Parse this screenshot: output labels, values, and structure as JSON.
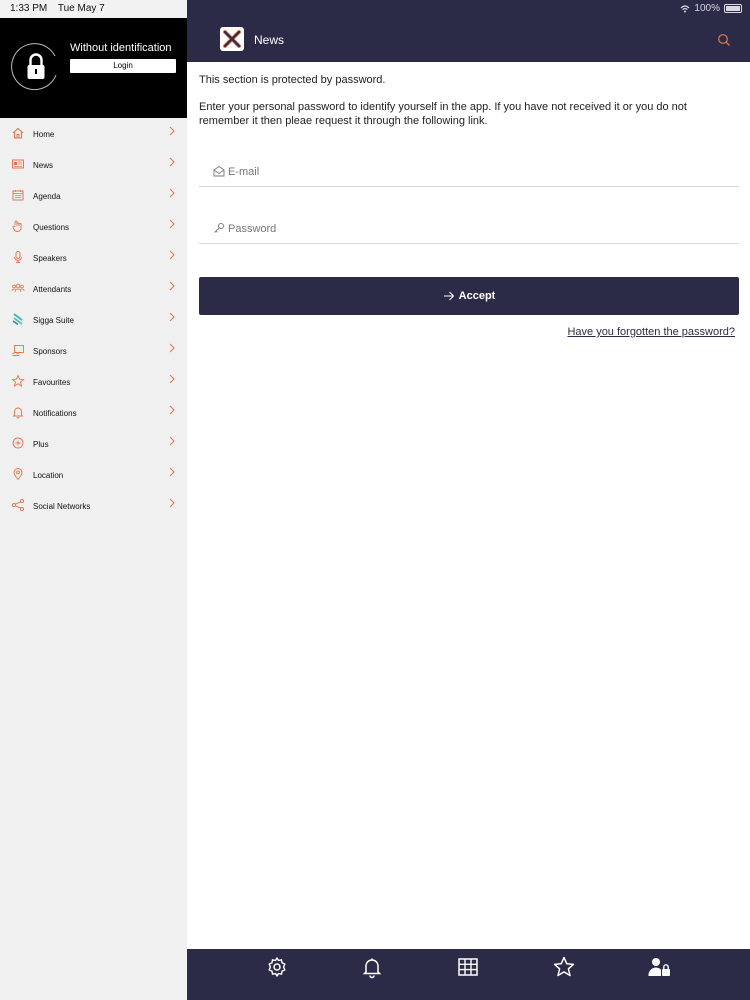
{
  "status_bar": {
    "time": "1:33 PM",
    "date": "Tue May 7",
    "battery": "100%"
  },
  "profile": {
    "name": "Without identification",
    "login_label": "Login"
  },
  "sidebar": {
    "items": [
      {
        "label": "Home",
        "icon": "home-icon"
      },
      {
        "label": "News",
        "icon": "newspaper-icon"
      },
      {
        "label": "Agenda",
        "icon": "calendar-icon"
      },
      {
        "label": "Questions",
        "icon": "hand-icon"
      },
      {
        "label": "Speakers",
        "icon": "microphone-icon"
      },
      {
        "label": "Attendants",
        "icon": "people-icon"
      },
      {
        "label": "Sigga Suite",
        "icon": "sigga-logo-icon"
      },
      {
        "label": "Sponsors",
        "icon": "sponsor-icon"
      },
      {
        "label": "Favourites",
        "icon": "star-icon"
      },
      {
        "label": "Notifications",
        "icon": "bell-icon"
      },
      {
        "label": "Plus",
        "icon": "plus-circle-icon"
      },
      {
        "label": "Location",
        "icon": "location-pin-icon"
      },
      {
        "label": "Social Networks",
        "icon": "share-icon"
      }
    ]
  },
  "header": {
    "title": "News"
  },
  "main": {
    "protected_text": "This section is protected by password.",
    "instruction_text": "Enter your personal password to identify yourself in the app. If you have not received it or you do not remember it then pleae request it through the following link.",
    "email": {
      "placeholder": "E-mail",
      "value": ""
    },
    "password": {
      "placeholder": "Password",
      "value": ""
    },
    "accept_label": "Accept",
    "forgot_label": "Have you forgotten the password?"
  },
  "tabbar": {
    "tabs": [
      {
        "icon": "gear-icon"
      },
      {
        "icon": "bell-icon"
      },
      {
        "icon": "grid-icon"
      },
      {
        "icon": "star-icon"
      },
      {
        "icon": "user-lock-icon"
      }
    ]
  },
  "colors": {
    "primary": "#2c2b47",
    "accent": "#e8734a",
    "sidebar_bg": "#f0f0f0",
    "profile_bg": "#000000"
  }
}
